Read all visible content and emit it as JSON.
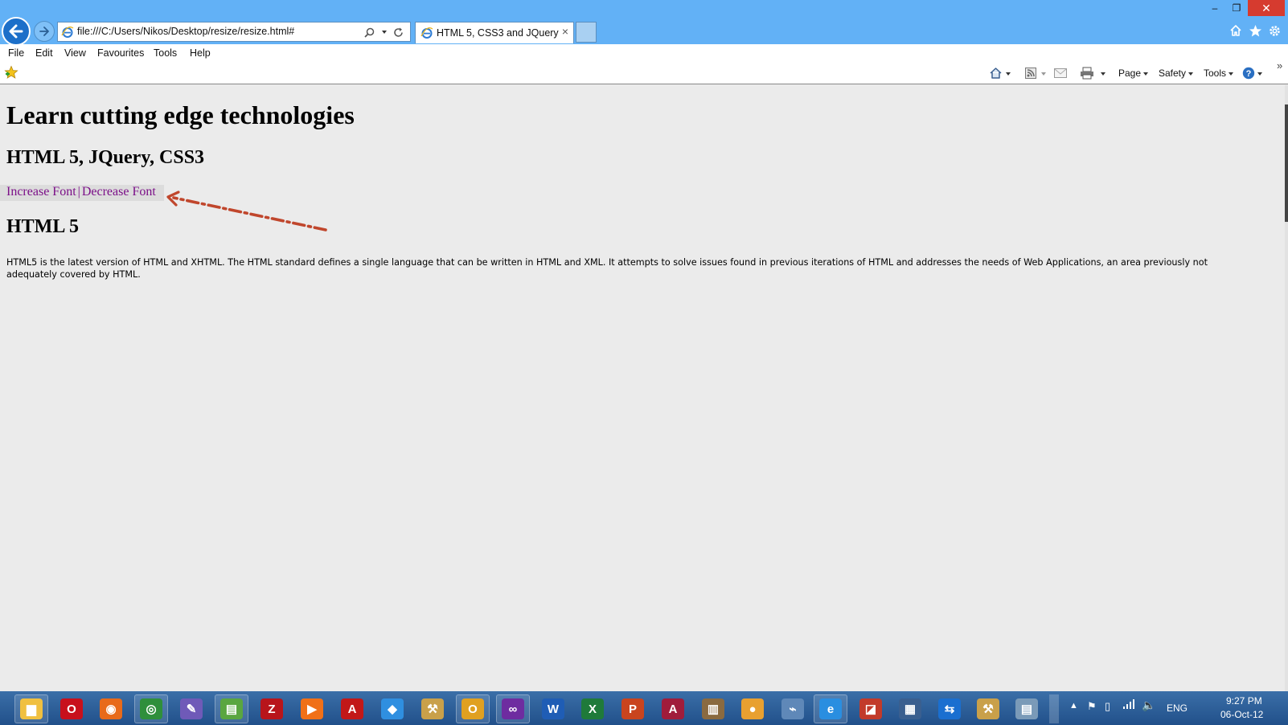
{
  "browser": {
    "address": "file:///C:/Users/Nikos/Desktop/resize/resize.html#",
    "tab_title": "HTML 5, CSS3 and JQuery",
    "tab_close": "×",
    "window_controls": {
      "minimize": "–",
      "restore": "❐",
      "close": "✕"
    }
  },
  "menu": {
    "items": [
      "File",
      "Edit",
      "View",
      "Favourites",
      "Tools",
      "Help"
    ]
  },
  "commandbar": {
    "page": "Page",
    "safety": "Safety",
    "tools": "Tools",
    "overflow": "»"
  },
  "page": {
    "heading": "Learn cutting edge technologies",
    "subheading": "HTML 5, JQuery, CSS3",
    "increase_font": "Increase Font",
    "separator": "|",
    "decrease_font": "Decrease Font",
    "section_heading": "HTML 5",
    "paragraph": "HTML5 is the latest version of HTML and XHTML. The HTML standard defines a single language that can be written in HTML and XML. It attempts to solve issues found in previous iterations of HTML and addresses the needs of Web Applications, an area previously not adequately covered by HTML."
  },
  "taskbar": {
    "icons": [
      "file-explorer-icon",
      "opera-icon",
      "firefox-icon",
      "chrome-icon",
      "color-picker-icon",
      "notepad-icon",
      "filezilla-icon",
      "media-player-icon",
      "acrobat-icon",
      "dropbox-icon",
      "tools-icon",
      "outlook-icon",
      "visual-studio-icon",
      "word-icon",
      "excel-icon",
      "powerpoint-icon",
      "access-icon",
      "movie-maker-icon",
      "paint-icon",
      "network-icon",
      "internet-explorer-icon",
      "pdf-editor-icon",
      "sql-icon",
      "teamviewer-icon",
      "tools-2-icon",
      "stack-icon"
    ],
    "language": "ENG",
    "time": "9:27 PM",
    "date": "06-Oct-12"
  },
  "colors": {
    "titlebar": "#62b1f6",
    "link": "#7b0f88",
    "arrow": "#c0462c",
    "taskbar": "#2c5f98"
  }
}
